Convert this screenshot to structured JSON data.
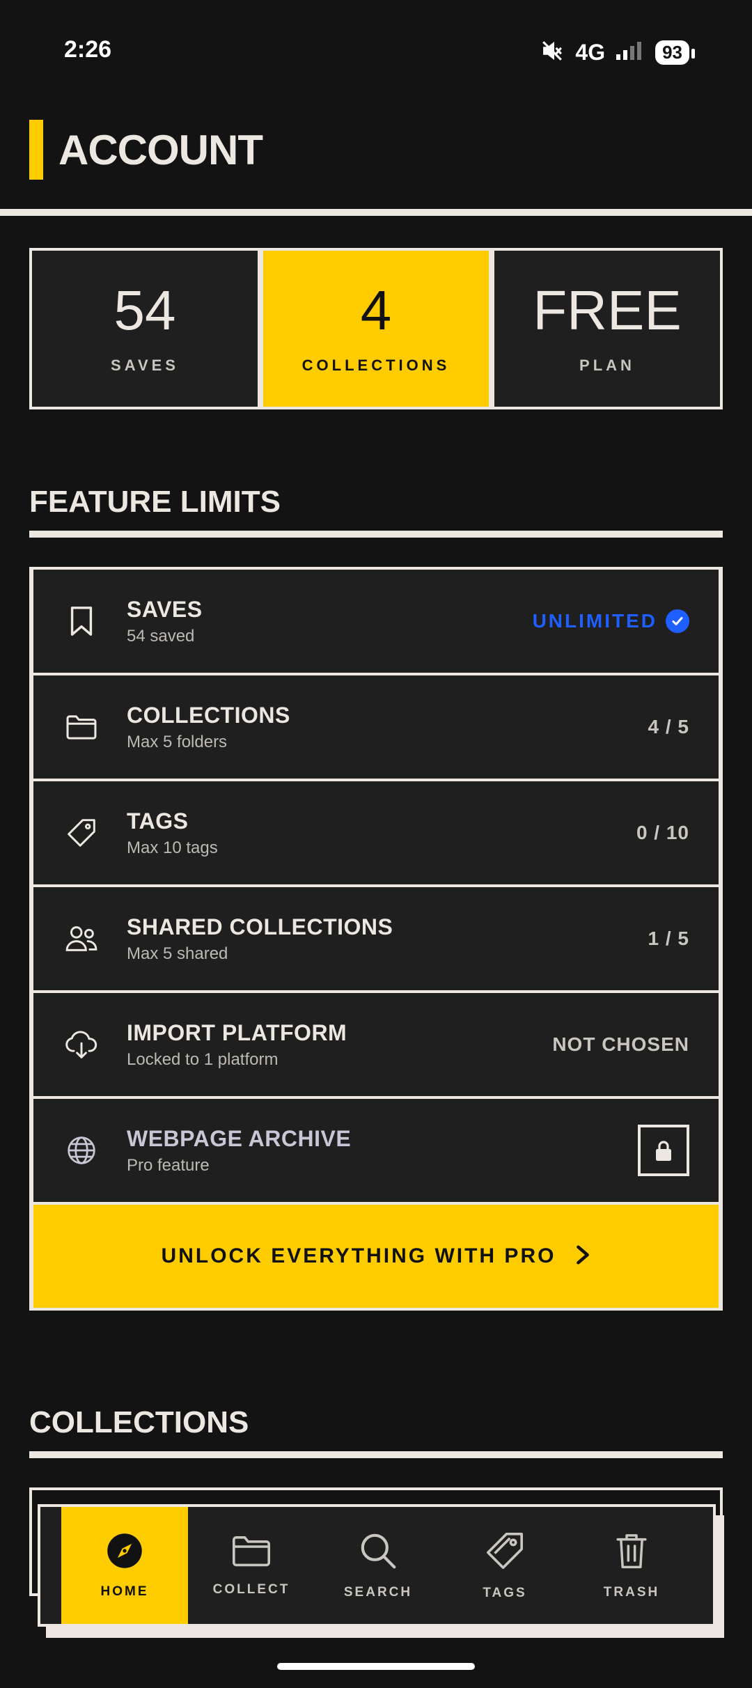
{
  "status": {
    "time": "2:26",
    "network": "4G",
    "battery": "93"
  },
  "header": {
    "title": "ACCOUNT"
  },
  "stats": [
    {
      "value": "54",
      "label": "SAVES"
    },
    {
      "value": "4",
      "label": "COLLECTIONS"
    },
    {
      "value": "FREE",
      "label": "PLAN"
    }
  ],
  "feature_limits": {
    "title": "FEATURE LIMITS",
    "items": [
      {
        "title": "SAVES",
        "subtitle": "54 saved",
        "value": "UNLIMITED",
        "icon": "bookmark-icon"
      },
      {
        "title": "COLLECTIONS",
        "subtitle": "Max 5 folders",
        "value": "4 / 5",
        "icon": "folder-icon"
      },
      {
        "title": "TAGS",
        "subtitle": "Max 10 tags",
        "value": "0 / 10",
        "icon": "tag-icon"
      },
      {
        "title": "SHARED COLLECTIONS",
        "subtitle": "Max 5 shared",
        "value": "1 / 5",
        "icon": "users-icon"
      },
      {
        "title": "IMPORT PLATFORM",
        "subtitle": "Locked to 1 platform",
        "value": "NOT CHOSEN",
        "icon": "cloud-download-icon"
      },
      {
        "title": "WEBPAGE ARCHIVE",
        "subtitle": "Pro feature",
        "icon": "globe-icon"
      }
    ],
    "pro_button": "UNLOCK EVERYTHING WITH PRO"
  },
  "collections": {
    "title": "COLLECTIONS"
  },
  "nav": [
    {
      "label": "HOME",
      "icon": "compass-icon"
    },
    {
      "label": "COLLECT",
      "icon": "folder-icon"
    },
    {
      "label": "SEARCH",
      "icon": "search-icon"
    },
    {
      "label": "TAGS",
      "icon": "tag-icon"
    },
    {
      "label": "TRASH",
      "icon": "trash-icon"
    }
  ],
  "colors": {
    "accent": "#FFCC00",
    "background": "#131313",
    "surface": "#1F1F1F",
    "text": "#ECE8E1",
    "blue": "#1F5FFF"
  }
}
